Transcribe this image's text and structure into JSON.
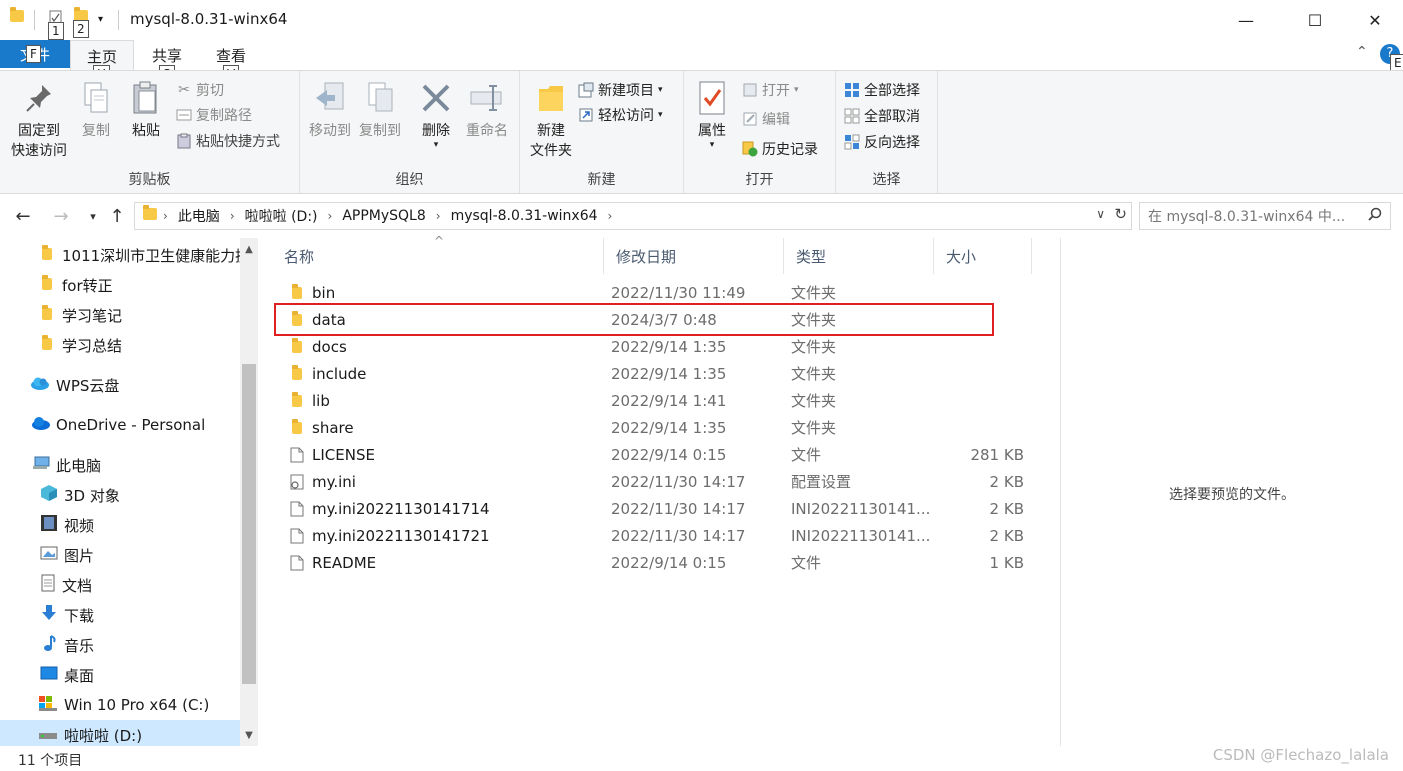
{
  "titlebar": {
    "title": "mysql-8.0.31-winx64",
    "keytips": [
      "1",
      "2"
    ],
    "minimize": "—",
    "maximize": "☐",
    "close": "✕"
  },
  "ribbon_tabs": {
    "file": "文件",
    "file_keytip": "F",
    "home": "主页",
    "home_keytip": "H",
    "share": "共享",
    "share_keytip": "S",
    "view": "查看",
    "view_keytip": "V",
    "help_keytip": "E"
  },
  "ribbon": {
    "clipboard": {
      "label": "剪贴板",
      "pin_line1": "固定到",
      "pin_line2": "快速访问",
      "copy": "复制",
      "paste": "粘贴",
      "cut": "剪切",
      "copy_path": "复制路径",
      "paste_shortcut": "粘贴快捷方式"
    },
    "organize": {
      "label": "组织",
      "move_to": "移动到",
      "copy_to": "复制到",
      "delete": "删除",
      "rename": "重命名"
    },
    "new": {
      "label": "新建",
      "new_folder_line1": "新建",
      "new_folder_line2": "文件夹",
      "new_item": "新建项目",
      "easy_access": "轻松访问"
    },
    "open": {
      "label": "打开",
      "properties": "属性",
      "open": "打开",
      "edit": "编辑",
      "history": "历史记录"
    },
    "select": {
      "label": "选择",
      "select_all": "全部选择",
      "select_none": "全部取消",
      "invert": "反向选择"
    }
  },
  "address": {
    "crumbs": [
      "此电脑",
      "啦啦啦 (D:)",
      "APPMySQL8",
      "mysql-8.0.31-winx64"
    ],
    "search_placeholder": "在 mysql-8.0.31-winx64 中..."
  },
  "navpane": {
    "items": [
      {
        "label": "1011深圳市卫生健康能力提",
        "icon": "folder-icon"
      },
      {
        "label": "for转正",
        "icon": "folder-icon"
      },
      {
        "label": "学习笔记",
        "icon": "folder-icon"
      },
      {
        "label": "学习总结",
        "icon": "folder-icon"
      },
      {
        "label": "WPS云盘",
        "icon": "cloud-icon"
      },
      {
        "label": "OneDrive - Personal",
        "icon": "onedrive-icon"
      },
      {
        "label": "此电脑",
        "icon": "computer-icon"
      },
      {
        "label": "3D 对象",
        "icon": "3d-objects-icon"
      },
      {
        "label": "视频",
        "icon": "video-icon"
      },
      {
        "label": "图片",
        "icon": "pictures-icon"
      },
      {
        "label": "文档",
        "icon": "documents-icon"
      },
      {
        "label": "下载",
        "icon": "download-icon"
      },
      {
        "label": "音乐",
        "icon": "music-icon"
      },
      {
        "label": "桌面",
        "icon": "desktop-icon"
      },
      {
        "label": "Win 10 Pro x64 (C:)",
        "icon": "drive-c-icon"
      },
      {
        "label": "啦啦啦 (D:)",
        "icon": "drive-d-icon"
      }
    ]
  },
  "columns": {
    "name": "名称",
    "date": "修改日期",
    "type": "类型",
    "size": "大小"
  },
  "files": [
    {
      "name": "bin",
      "date": "2022/11/30 11:49",
      "type": "文件夹",
      "size": "",
      "kind": "folder"
    },
    {
      "name": "data",
      "date": "2024/3/7 0:48",
      "type": "文件夹",
      "size": "",
      "kind": "folder"
    },
    {
      "name": "docs",
      "date": "2022/9/14 1:35",
      "type": "文件夹",
      "size": "",
      "kind": "folder"
    },
    {
      "name": "include",
      "date": "2022/9/14 1:35",
      "type": "文件夹",
      "size": "",
      "kind": "folder"
    },
    {
      "name": "lib",
      "date": "2022/9/14 1:41",
      "type": "文件夹",
      "size": "",
      "kind": "folder"
    },
    {
      "name": "share",
      "date": "2022/9/14 1:35",
      "type": "文件夹",
      "size": "",
      "kind": "folder"
    },
    {
      "name": "LICENSE",
      "date": "2022/9/14 0:15",
      "type": "文件",
      "size": "281 KB",
      "kind": "file"
    },
    {
      "name": "my.ini",
      "date": "2022/11/30 14:17",
      "type": "配置设置",
      "size": "2 KB",
      "kind": "ini"
    },
    {
      "name": "my.ini20221130141714",
      "date": "2022/11/30 14:17",
      "type": "INI20221130141...",
      "size": "2 KB",
      "kind": "file"
    },
    {
      "name": "my.ini20221130141721",
      "date": "2022/11/30 14:17",
      "type": "INI20221130141...",
      "size": "2 KB",
      "kind": "file"
    },
    {
      "name": "README",
      "date": "2022/9/14 0:15",
      "type": "文件",
      "size": "1 KB",
      "kind": "file"
    }
  ],
  "preview": {
    "text": "选择要预览的文件。"
  },
  "status": {
    "count": "11 个项目",
    "watermark": "CSDN @Flechazo_lalala"
  }
}
